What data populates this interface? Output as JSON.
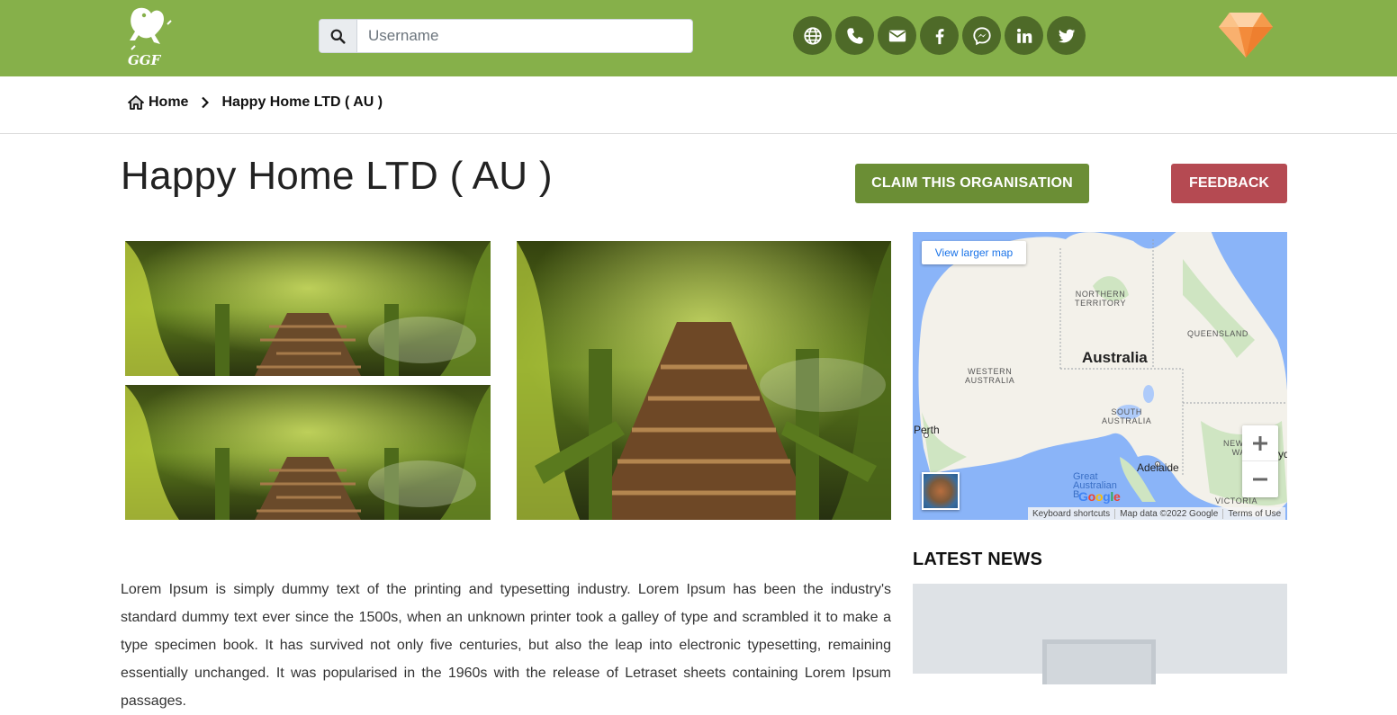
{
  "header": {
    "logo_text": "GGF",
    "search_placeholder": "Username",
    "search_value": "",
    "social_icons": [
      "globe-icon",
      "phone-icon",
      "envelope-icon",
      "facebook-icon",
      "messenger-icon",
      "linkedin-icon",
      "twitter-icon"
    ],
    "premium_icon": "diamond-icon",
    "bg_color": "#86b04a",
    "icon_bg_color": "#4e6a28"
  },
  "breadcrumb": {
    "home_label": "Home",
    "current_label": "Happy Home LTD ( AU )"
  },
  "page": {
    "title": "Happy Home LTD ( AU )",
    "claim_label": "CLAIM THIS ORGANISATION",
    "feedback_label": "FEEDBACK",
    "claim_color": "#6b8e35",
    "feedback_color": "#b54a52",
    "description": "Lorem Ipsum is simply dummy text of the printing and typesetting industry. Lorem Ipsum has been the industry's standard dummy text ever since the 1500s, when an unknown printer took a galley of type and scrambled it to make a type specimen book. It has survived not only five centuries, but also the leap into electronic typesetting, remaining essentially unchanged. It was popularised in the 1960s with the release of Letraset sheets containing Lorem Ipsum passages."
  },
  "map": {
    "view_larger": "View larger map",
    "country": "Australia",
    "regions": {
      "northern_territory": "NORTHERN\nTERRITORY",
      "queensland": "QUEENSLAND",
      "western_australia": "WESTERN\nAUSTRALIA",
      "south_australia": "SOUTH\nAUSTRALIA",
      "new_south_wales": "NEW SO\nWAL"
    },
    "cities": {
      "perth": "Perth",
      "adelaide": "Adelaide",
      "sydney": "yd",
      "victoria": "VICTORIA"
    },
    "water": "Great\nAustralian\nB",
    "google": "Google",
    "attribution": [
      "Keyboard shortcuts",
      "Map data ©2022 Google",
      "Terms of Use"
    ]
  },
  "news": {
    "title": "LATEST NEWS"
  }
}
